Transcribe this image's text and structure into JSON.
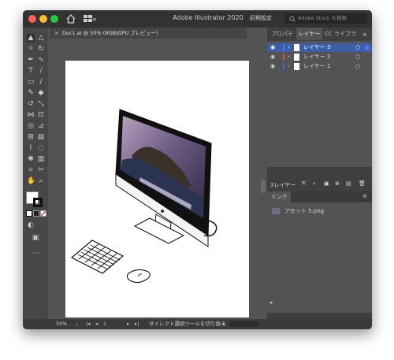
{
  "titlebar": {
    "app_title": "Adobe Illustrator 2020",
    "workspace": "初期設定",
    "stock_search_placeholder": "Adobe Stock を検索"
  },
  "document": {
    "tab_label": "Doc1.ai @ 50% (RGB/GPU プレビュー)"
  },
  "right_panel": {
    "tabs": [
      "プロパティ",
      "レイヤー",
      "CC ライブラリ"
    ],
    "active_tab": 1,
    "layers": [
      {
        "name": "レイヤー 3",
        "color": "#4f7cff",
        "selected": true
      },
      {
        "name": "レイヤー 2",
        "color": "#e34c4c",
        "selected": false
      },
      {
        "name": "レイヤー 1",
        "color": "#3d6be0",
        "selected": false
      }
    ],
    "layer_count": "3レイヤー",
    "links_tab": "リンク",
    "links": [
      {
        "name": "アセット 5.png"
      }
    ]
  },
  "status": {
    "zoom": "50%",
    "artboard_number": "1",
    "message": "ダイレクト選択ツールを切り換え"
  },
  "icons": [
    "home-icon",
    "workspace-icon",
    "search-icon",
    "selection-tool-icon",
    "direct-selection-tool-icon",
    "pen-tool-icon",
    "type-tool-icon",
    "rectangle-tool-icon",
    "brush-tool-icon",
    "eyedropper-tool-icon",
    "hand-tool-icon",
    "zoom-tool-icon",
    "eye-icon",
    "lock-icon",
    "new-layer-icon",
    "trash-icon"
  ]
}
